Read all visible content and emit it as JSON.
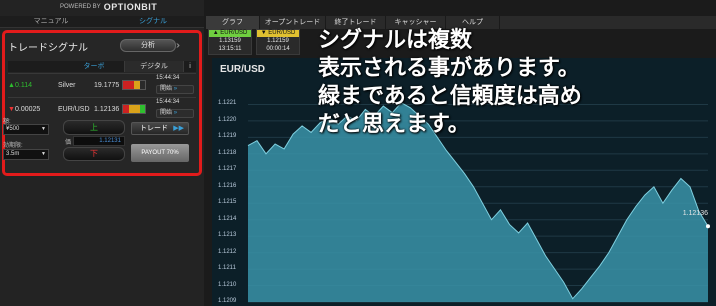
{
  "brand": {
    "powered_by": "POWERED BY",
    "name": "OPTIONBIT"
  },
  "left_nav": [
    {
      "label": "マニュアル",
      "active": false
    },
    {
      "label": "シグナル",
      "active": true
    }
  ],
  "signal_panel": {
    "title": "トレードシグナル",
    "analyze_label": "分析",
    "tabs": {
      "turbo": "ターボ",
      "digital": "デジタル",
      "info": "i"
    },
    "rows": [
      {
        "direction": "up",
        "arrow": "▲",
        "change": "0.114",
        "pair": "Silver",
        "price": "19.1775",
        "clock": "15:44:34",
        "open_label": "開始"
      },
      {
        "direction": "down",
        "arrow": "▼",
        "change": "0.00025",
        "pair": "EUR/USD",
        "price": "1.12136",
        "clock": "15:44:34",
        "open_label": "開始"
      }
    ],
    "amount_label": "額:",
    "amount_value": "¥500",
    "expiry_label": "効期限:",
    "expiry_value": "3.5m",
    "up_label": "上",
    "down_label": "下",
    "price_label": "価",
    "price_value": "1.12131",
    "trade_label": "トレード",
    "payout_label": "PAYOUT 70%"
  },
  "right_nav": [
    {
      "label": "グラフ",
      "active": true
    },
    {
      "label": "オープントレード",
      "active": false
    },
    {
      "label": "終了トレード",
      "active": false
    },
    {
      "label": "キャッシャー",
      "active": false
    },
    {
      "label": "ヘルプ",
      "active": false
    }
  ],
  "quotes": [
    {
      "header": "▲ EUR/USD",
      "price": "1.13159",
      "time": "13:15:11",
      "color": "#6fcf3f"
    },
    {
      "header": "▼ EUR/USD",
      "price": "1.12159",
      "time": "00:00:14",
      "color": "#e0c030"
    }
  ],
  "chart": {
    "title": "EUR/USD",
    "last_price": "1.12136"
  },
  "chart_data": {
    "type": "area",
    "title": "EUR/USD",
    "y_ticks": [
      "1.1221",
      "1.1220",
      "1.1219",
      "1.1218",
      "1.1217",
      "1.1216",
      "1.1215",
      "1.1214",
      "1.1213",
      "1.1212",
      "1.1211",
      "1.1210",
      "1.1209"
    ],
    "ylim": [
      1.1209,
      1.1222
    ],
    "values": [
      1.12185,
      1.12188,
      1.1218,
      1.12186,
      1.12183,
      1.12192,
      1.12197,
      1.12193,
      1.12199,
      1.12202,
      1.12198,
      1.12203,
      1.122,
      1.12207,
      1.12203,
      1.12209,
      1.12205,
      1.12211,
      1.12208,
      1.12203,
      1.12198,
      1.1219,
      1.12182,
      1.12175,
      1.12168,
      1.1216,
      1.1215,
      1.1214,
      1.12146,
      1.12137,
      1.12132,
      1.12138,
      1.12128,
      1.12118,
      1.1211,
      1.12102,
      1.12092,
      1.12098,
      1.12105,
      1.12112,
      1.1212,
      1.1213,
      1.1214,
      1.12148,
      1.12155,
      1.1216,
      1.1215,
      1.12158,
      1.12165,
      1.1216,
      1.12145,
      1.12136
    ],
    "last_value": 1.12136,
    "grid": true,
    "fill_color": "#3a93a8",
    "line_color": "#7fd0e0"
  },
  "caption": {
    "lines": [
      "シグナルは複数",
      "表示される事があります。",
      "緑まであると信頼度は高め",
      "だと思えます。"
    ]
  }
}
